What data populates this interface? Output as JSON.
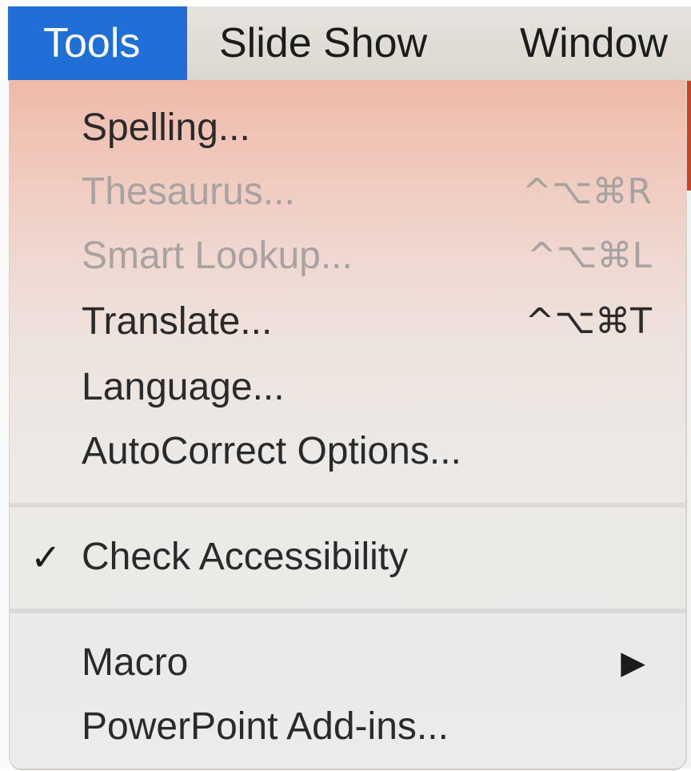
{
  "menubar": {
    "items": [
      {
        "label": "Tools",
        "active": true
      },
      {
        "label": "Slide Show",
        "active": false
      },
      {
        "label": "Window",
        "active": false
      }
    ]
  },
  "menu": {
    "items": [
      {
        "label": "Spelling...",
        "shortcut": "",
        "enabled": true
      },
      {
        "label": "Thesaurus...",
        "shortcut": "^⌥⌘R",
        "enabled": false
      },
      {
        "label": "Smart Lookup...",
        "shortcut": "^⌥⌘L",
        "enabled": false
      },
      {
        "label": "Translate...",
        "shortcut": "^⌥⌘T",
        "enabled": true
      },
      {
        "label": "Language...",
        "shortcut": "",
        "enabled": true
      },
      {
        "label": "AutoCorrect Options...",
        "shortcut": "",
        "enabled": true
      },
      {
        "label": "Check Accessibility",
        "checked": true,
        "check_mark": "✓",
        "enabled": true
      },
      {
        "label": "Macro",
        "submenu_arrow": "▶",
        "enabled": true
      },
      {
        "label": "PowerPoint Add-ins...",
        "shortcut": "",
        "enabled": true
      }
    ]
  },
  "colors": {
    "menubar_active": "#1f6fd6",
    "disabled_text": "#a8a2a0",
    "menu_gradient_top": "#efbaa9",
    "menu_background": "#ecebe9"
  }
}
